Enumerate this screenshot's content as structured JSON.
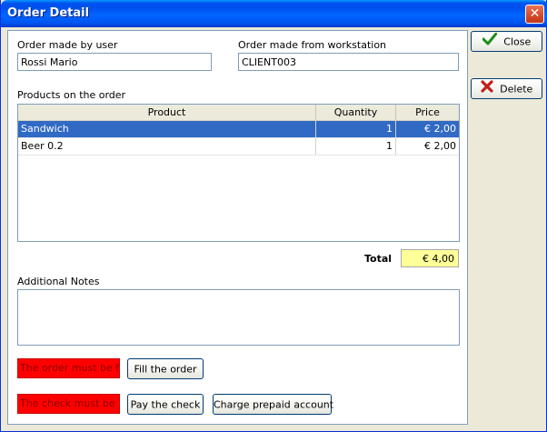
{
  "window": {
    "title": "Order Detail",
    "close_glyph": "✕"
  },
  "order": {
    "user_label": "Order made by user",
    "user_value": "Rossi Mario",
    "workstation_label": "Order made from workstation",
    "workstation_value": "CLIENT003"
  },
  "products": {
    "label": "Products on the order",
    "columns": [
      "Product",
      "Quantity",
      "Price"
    ],
    "rows": [
      {
        "product": "Sandwich",
        "quantity": "1",
        "price": "€ 2,00",
        "selected": true
      },
      {
        "product": "Beer 0.2",
        "quantity": "1",
        "price": "€ 2,00",
        "selected": false
      }
    ]
  },
  "total": {
    "label": "Total",
    "value": "€ 4,00"
  },
  "notes": {
    "label": "Additional Notes",
    "value": ""
  },
  "status": {
    "fill_message": "The order must be fille",
    "fill_button": "Fill the order",
    "check_message": "The check must be pai",
    "pay_button": "Pay the check",
    "prepaid_button": "Charge prepaid account"
  },
  "side_buttons": {
    "close": "Close",
    "delete": "Delete"
  },
  "colors": {
    "selected_row": "#316ac5",
    "status_red": "#ff0000",
    "total_bg": "#ffff99"
  },
  "icons": {
    "close": "checkmark-icon",
    "delete": "red-x-icon"
  }
}
